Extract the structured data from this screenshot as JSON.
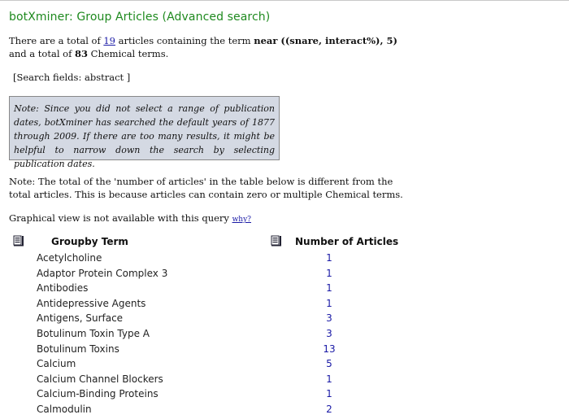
{
  "header": {
    "title": "botXminer: Group Articles (Advanced search)"
  },
  "summary": {
    "prefix": "There are a total of ",
    "article_count": "19",
    "middle": " articles containing the term ",
    "term": "near ((snare, interact%), 5)",
    "and_text": " and a total of ",
    "chemical_count": "83",
    "suffix": " Chemical terms."
  },
  "search_fields": "[Search fields: abstract ]",
  "note": "Note: Since you did not select a range of publication dates, botXminer has searched the default years of 1877 through 2009. If there are too many results, it might be helpful to narrow down the search by selecting publication dates.",
  "total_note": "Note: The total of the 'number of articles' in the table below is different from the total articles. This is because articles can contain zero or multiple Chemical terms.",
  "graphical": {
    "text": "Graphical view is not available with this query ",
    "link": "why?"
  },
  "table": {
    "col_term": "Groupby Term",
    "col_count": "Number of Articles",
    "rows": [
      {
        "term": "Acetylcholine",
        "count": "1"
      },
      {
        "term": "Adaptor Protein Complex 3",
        "count": "1"
      },
      {
        "term": "Antibodies",
        "count": "1"
      },
      {
        "term": "Antidepressive Agents",
        "count": "1"
      },
      {
        "term": "Antigens, Surface",
        "count": "3"
      },
      {
        "term": "Botulinum Toxin Type A",
        "count": "3"
      },
      {
        "term": "Botulinum Toxins",
        "count": "13"
      },
      {
        "term": "Calcium",
        "count": "5"
      },
      {
        "term": "Calcium Channel Blockers",
        "count": "1"
      },
      {
        "term": "Calcium-Binding Proteins",
        "count": "1"
      },
      {
        "term": "Calmodulin",
        "count": "2"
      }
    ]
  },
  "icons": {
    "sort_icon": "sort-list-icon"
  },
  "colors": {
    "title": "#1f8a1f",
    "link": "#1a1aa6",
    "note_bg": "#d4d9e3"
  }
}
